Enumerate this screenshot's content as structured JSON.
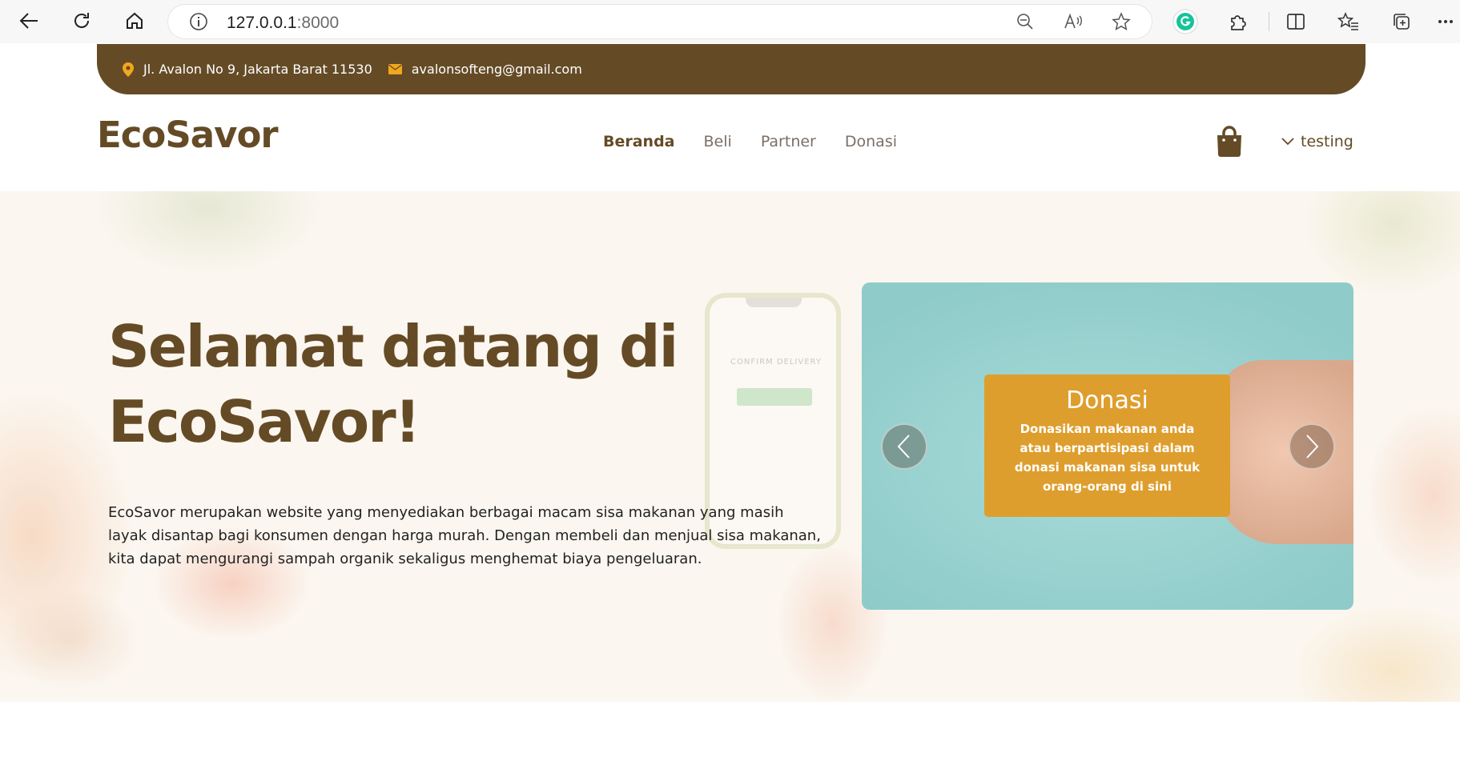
{
  "browser": {
    "url_host": "127.0.0.1",
    "url_port": ":8000",
    "icons": [
      "back-icon",
      "reload-icon",
      "home-icon",
      "info-icon",
      "zoom-out-icon",
      "read-aloud-icon",
      "favorite-star-icon",
      "grammarly-icon",
      "extensions-icon",
      "split-screen-icon",
      "favorites-icon",
      "collections-icon",
      "more-icon"
    ]
  },
  "topbar": {
    "address": "Jl. Avalon No 9, Jakarta Barat 11530",
    "email": "avalonsofteng@gmail.com",
    "color": "#644b26"
  },
  "header": {
    "brand": "EcoSavor",
    "nav": [
      {
        "label": "Beranda",
        "active": true
      },
      {
        "label": "Beli",
        "active": false
      },
      {
        "label": "Partner",
        "active": false
      },
      {
        "label": "Donasi",
        "active": false
      }
    ],
    "user": "testing"
  },
  "hero": {
    "title_line1": "Selamat datang di",
    "title_line2": "EcoSavor!",
    "description": "EcoSavor merupakan website yang menyediakan berbagai macam sisa makanan yang masih layak disantap bagi konsumen dengan harga murah. Dengan membeli dan menjual sisa makanan, kita dapat mengurangi sampah organik sekaligus menghemat biaya pengeluaran.",
    "phone_text": "CONFIRM DELIVERY"
  },
  "carousel": {
    "slide_title": "Donasi",
    "slide_text": "Donasikan makanan anda atau berpartisipasi dalam donasi makanan sisa untuk orang-orang di sini",
    "caption_color": "#de9e2d"
  }
}
